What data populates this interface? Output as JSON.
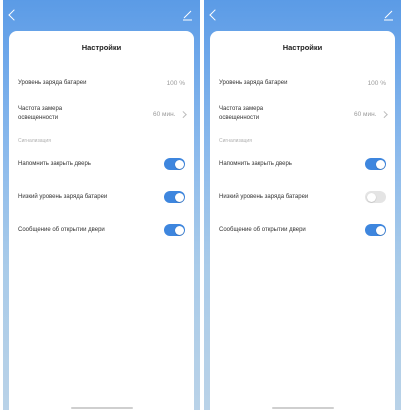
{
  "screens": [
    {
      "title": "Настройки",
      "battery_label": "Уровень заряда батареи",
      "battery_value": "100 %",
      "interval_label_line1": "Частота замера",
      "interval_label_line2": "освещенности",
      "interval_value": "60 мин.",
      "section_label": "Сигнализация",
      "toggles": [
        {
          "label": "Напомнить закрыть дверь",
          "on": true
        },
        {
          "label": "Низкий уровень заряда батареи",
          "on": true
        },
        {
          "label": "Сообщение об открытии двери",
          "on": true
        }
      ]
    },
    {
      "title": "Настройки",
      "battery_label": "Уровень заряда батареи",
      "battery_value": "100 %",
      "interval_label_line1": "Частота замера",
      "interval_label_line2": "освещенности",
      "interval_value": "60 мин.",
      "section_label": "Сигнализация",
      "toggles": [
        {
          "label": "Напомнить закрыть дверь",
          "on": true
        },
        {
          "label": "Низкий уровень заряда батареи",
          "on": false
        },
        {
          "label": "Сообщение об открытии двери",
          "on": true
        }
      ]
    }
  ],
  "colors": {
    "toggle_on": "#3e86de",
    "toggle_off": "#e4e4e4",
    "header_gradient_top": "#5b9be6"
  },
  "icons": {
    "back": "back-icon",
    "edit": "edit-icon",
    "chevron": "chevron-right-icon"
  }
}
